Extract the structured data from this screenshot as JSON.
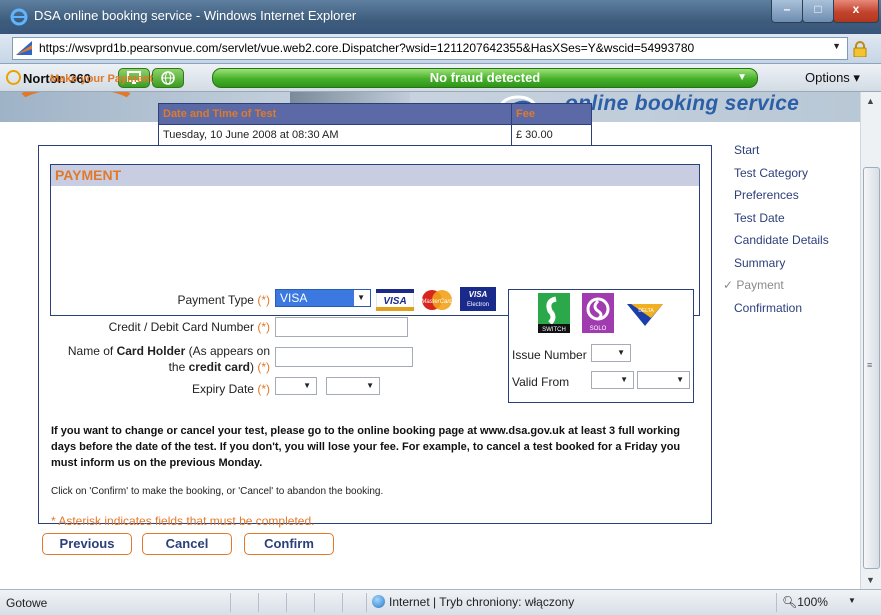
{
  "window": {
    "title": "DSA online booking service - Windows Internet Explorer",
    "minimize": "–",
    "maximize": "□",
    "close": "x"
  },
  "address_bar": {
    "url": "https://wsvprd1b.pearsonvue.com/servlet/vue.web2.core.Dispatcher?wsid=1211207642355&HasXSes=Y&wscid=54993780"
  },
  "norton": {
    "name": "Norton 360",
    "status": "No fraud detected",
    "options": "Options ▾"
  },
  "banner": {
    "service": "online booking service"
  },
  "page": {
    "heading": "Make your Payment",
    "fee_table": {
      "headers": [
        "Date and Time of Test",
        "Fee"
      ],
      "row": [
        "Tuesday, 10 June 2008 at 08:30 AM",
        "£ 30.00"
      ]
    },
    "payment": {
      "heading": "PAYMENT",
      "payment_type_label": "Payment Type",
      "payment_type_value": "VISA",
      "card_number_label": "Credit / Debit Card Number",
      "holder_label_1": "Name of",
      "holder_label_bold": "Card Holder",
      "holder_label_2": "(As appears on",
      "holder_label_3a": "the",
      "holder_label_3_bold": "credit card",
      "holder_label_3b": ")",
      "expiry_label": "Expiry Date",
      "required_mark": "(*)",
      "issue_number_label": "Issue Number",
      "valid_from_label": "Valid From",
      "cards": [
        "VISA",
        "MasterCard",
        "VISA Electron",
        "SWITCH",
        "SOLO",
        "DELTA"
      ]
    },
    "info_text": "If you want to change or cancel your test, please go to the online booking page at www.dsa.gov.uk at least 3 full working days before the date of the test. If you don't, you will lose your fee. For example, to cancel a test booked for a Friday you must inform us on the previous Monday.",
    "click_text": "Click on 'Confirm' to make the booking, or 'Cancel' to abandon the booking.",
    "asterisk_note": "* Asterisk indicates fields that must be completed.",
    "buttons": {
      "previous": "Previous",
      "cancel": "Cancel",
      "confirm": "Confirm"
    }
  },
  "nav": {
    "items": [
      "Start",
      "Test Category",
      "Preferences",
      "Test Date",
      "Candidate Details",
      "Summary",
      "✓ Payment",
      "Confirmation"
    ],
    "current": "Payment"
  },
  "status_bar": {
    "text": "Gotowe",
    "zone": "Internet | Tryb chroniony: włączony",
    "zoom": "100%"
  },
  "colors": {
    "accent_orange": "#e07a2a",
    "navy": "#2b3f7a",
    "fraud_green": "#45b02a"
  }
}
